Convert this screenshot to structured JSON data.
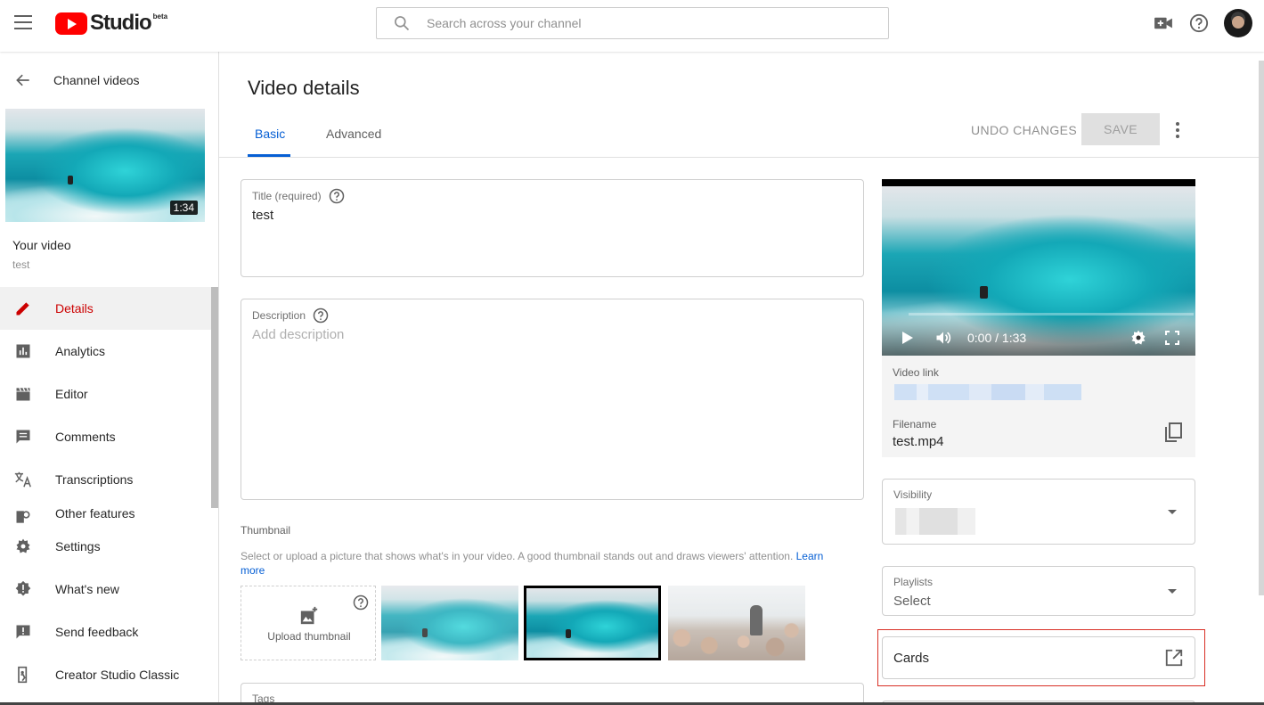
{
  "header": {
    "logo_text": "Studio",
    "logo_badge": "beta",
    "search_placeholder": "Search across your channel"
  },
  "sidebar": {
    "back_label": "Channel videos",
    "thumbnail_duration": "1:34",
    "video_heading": "Your video",
    "video_name": "test",
    "nav_items": [
      {
        "label": "Details",
        "icon": "pencil-icon",
        "active": true
      },
      {
        "label": "Analytics",
        "icon": "bar-chart-icon"
      },
      {
        "label": "Editor",
        "icon": "clapperboard-icon"
      },
      {
        "label": "Comments",
        "icon": "comment-icon"
      },
      {
        "label": "Transcriptions",
        "icon": "translate-icon"
      },
      {
        "label": "Other features",
        "icon": "search-doc-icon"
      }
    ],
    "footer_items": [
      {
        "label": "Settings",
        "icon": "gear-icon"
      },
      {
        "label": "What's new",
        "icon": "new-badge-icon"
      },
      {
        "label": "Send feedback",
        "icon": "feedback-icon"
      },
      {
        "label": "Creator Studio Classic",
        "icon": "exit-icon"
      }
    ]
  },
  "main": {
    "page_title": "Video details",
    "tabs": [
      {
        "label": "Basic",
        "active": true
      },
      {
        "label": "Advanced"
      }
    ],
    "undo_label": "UNDO CHANGES",
    "save_label": "SAVE",
    "title_field": {
      "label": "Title (required)",
      "value": "test"
    },
    "description_field": {
      "label": "Description",
      "placeholder": "Add description"
    },
    "thumbnail": {
      "heading": "Thumbnail",
      "description": "Select or upload a picture that shows what's in your video. A good thumbnail stands out and draws viewers' attention.",
      "learn_more": "Learn more",
      "upload_label": "Upload thumbnail"
    },
    "tags_label": "Tags"
  },
  "right_panel": {
    "player_time": "0:00 / 1:33",
    "video_link_label": "Video link",
    "filename_label": "Filename",
    "filename_value": "test.mp4",
    "visibility_label": "Visibility",
    "playlists_label": "Playlists",
    "playlists_value": "Select",
    "cards_label": "Cards"
  },
  "colors": {
    "accent_blue": "#065fd4",
    "active_red": "#cc0000",
    "youtube_red": "#ff0000",
    "highlight_outline": "#d93025"
  }
}
